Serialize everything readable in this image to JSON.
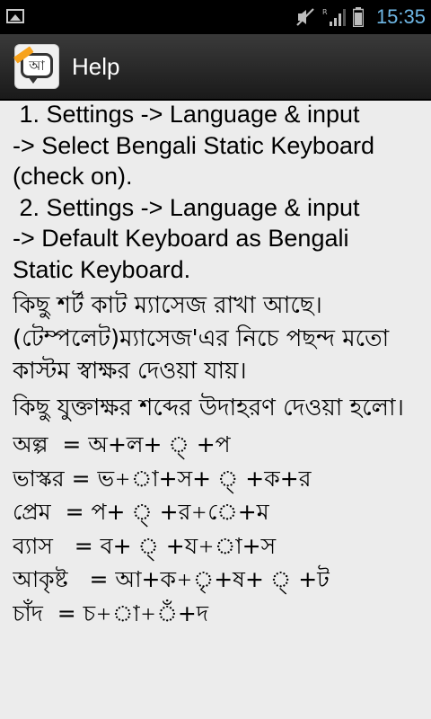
{
  "status_bar": {
    "time": "15:35",
    "icons": [
      "picture-icon",
      "mute-icon",
      "signal-icon",
      "battery-icon"
    ]
  },
  "action_bar": {
    "title": "Help",
    "app_icon_letter": "আ"
  },
  "instructions": [
    " 1. Settings -> Language & input",
    "-> Select Bengali Static Keyboard",
    "(check on).",
    " 2. Settings -> Language & input",
    "-> Default Keyboard as Bengali",
    "Static Keyboard."
  ],
  "bengali_notes": [
    "কিছু শর্ট কাট ম্যাসেজ রাখা আছে।(টেম্পলেট)ম্যাসেজ'এর নিচে পছন্দ মতো কাস্টম স্বাক্ষর দেওয়া যায়।",
    "কিছু যুক্তাক্ষর শব্দের উদাহরণ দেওয়া হলো।"
  ],
  "examples": [
    "অল্প  = অ+ল+ ্ +প",
    "ভাস্কর = ভ+া+স+ ্ +ক+র",
    "প্রেম  = প+ ্ +র+ে+ম",
    "ব্যাস   = ব+ ্ +য+া+স",
    "আকৃষ্ট   = আ+ক+ৃ+ষ+ ্ +ট",
    "চাঁদ  = চ+া+ঁ+দ"
  ]
}
